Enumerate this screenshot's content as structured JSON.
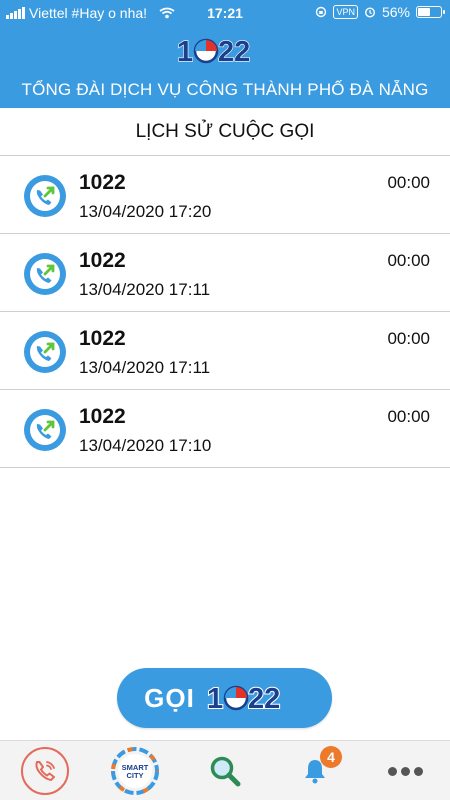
{
  "status_bar": {
    "carrier": "Viettel #Hay o nha!",
    "time": "17:21",
    "vpn": "VPN",
    "battery": "56%",
    "battery_level": 0.56
  },
  "header": {
    "logo_text": "1022",
    "title": "TỔNG ĐÀI DỊCH VỤ CÔNG THÀNH PHỐ ĐÀ NẴNG"
  },
  "history": {
    "title": "LỊCH SỬ CUỘC GỌI",
    "items": [
      {
        "number": "1022",
        "time": "13/04/2020 17:20",
        "duration": "00:00"
      },
      {
        "number": "1022",
        "time": "13/04/2020 17:11",
        "duration": "00:00"
      },
      {
        "number": "1022",
        "time": "13/04/2020 17:11",
        "duration": "00:00"
      },
      {
        "number": "1022",
        "time": "13/04/2020 17:10",
        "duration": "00:00"
      }
    ]
  },
  "call_button": {
    "label": "GỌI",
    "logo_text": "1022"
  },
  "tabs": {
    "phone_icon": "phone-icon",
    "smart_city_text": [
      "SMART",
      "CITY"
    ],
    "search_icon": "search-icon",
    "bell_icon": "bell-icon",
    "notification_count": "4",
    "more_icon": "more-icon"
  },
  "colors": {
    "primary": "#3a9be0",
    "outgoing_arrow": "#5fc53a",
    "badge": "#ec7a2a",
    "phone_tab": "#e36b5a",
    "logo_navy": "#1a3f8c",
    "logo_red": "#e2332b"
  }
}
